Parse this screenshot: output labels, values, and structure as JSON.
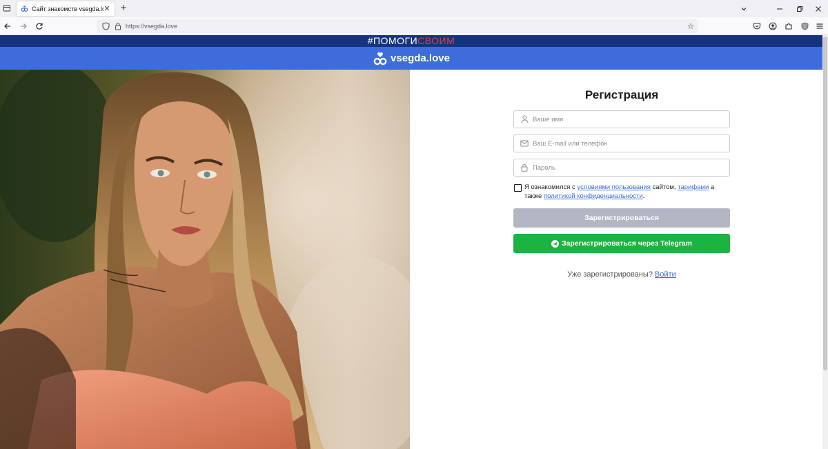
{
  "browser": {
    "tab_title": "Сайт знакомств vsegda.love",
    "url": "https://vsegda.love",
    "tab_close": "✕",
    "new_tab": "+"
  },
  "promo": {
    "part1": "#ПОМОГИ",
    "part2": "СВОИМ",
    "accent_color": "#e23b4e",
    "bg_color": "#16337f"
  },
  "brand": {
    "name": "vsegda.love",
    "bar_color": "#3d6ddb"
  },
  "form": {
    "title": "Регистрация",
    "name_placeholder": "Ваше имя",
    "contact_placeholder": "Ваш E-mail или телефон",
    "password_placeholder": "Пароль",
    "agree_prefix": "Я ознакомился с ",
    "terms_link": "условиями пользования",
    "agree_mid": " сайтом, ",
    "tariffs_link": "тарифами",
    "agree_mid2": " а также ",
    "privacy_link": "политикой конфиденциальности",
    "agree_suffix": ".",
    "agree_checked": false,
    "register_button": "Зарегистрироваться",
    "telegram_button": "Зарегистрироваться через Telegram",
    "already_registered": "Уже зарегистрированы?",
    "login_link": "Войти"
  },
  "colors": {
    "disabled_button": "#b3b7c4",
    "telegram_button": "#1db343",
    "link": "#3a6fd8"
  }
}
